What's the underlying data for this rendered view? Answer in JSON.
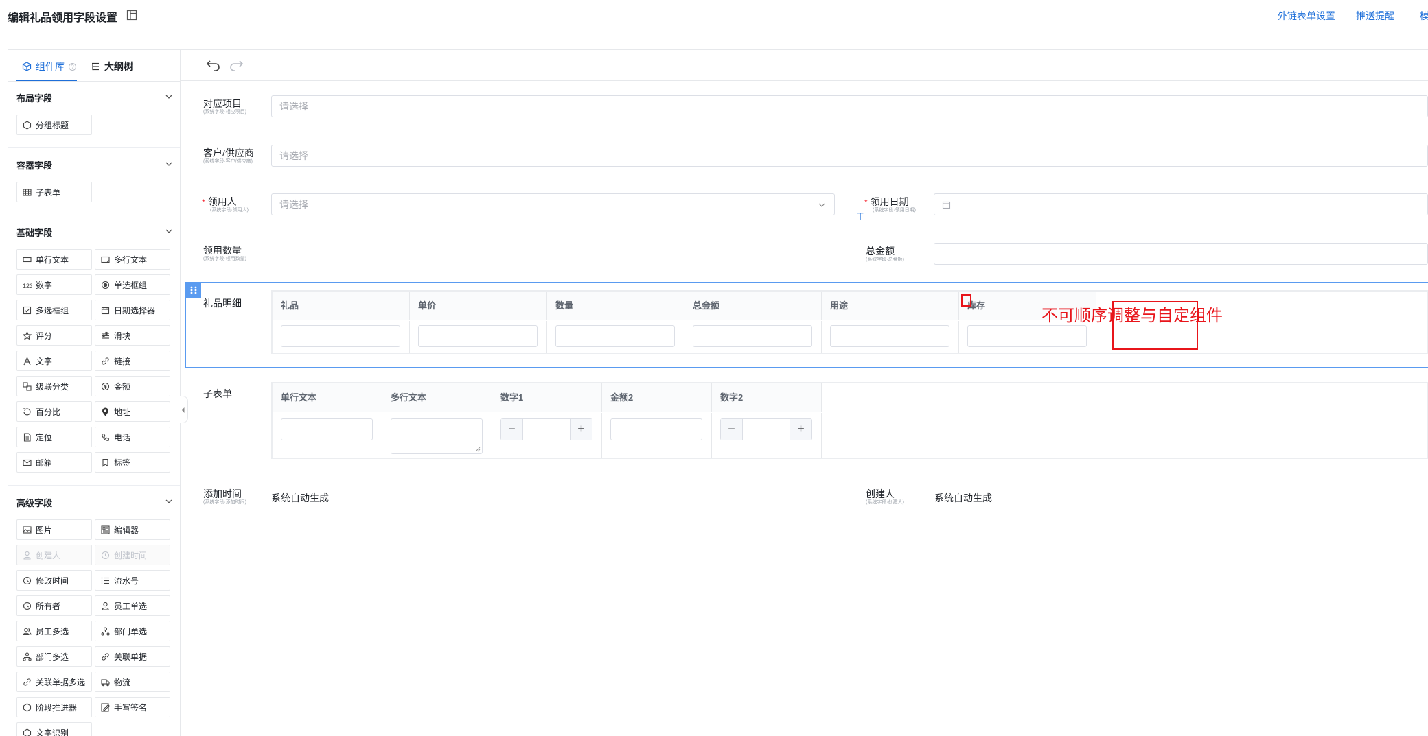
{
  "header": {
    "title": "编辑礼品领用字段设置",
    "links": [
      "外链表单设置",
      "推送提醒",
      "模"
    ]
  },
  "left_panel": {
    "tabs": [
      {
        "label": "组件库",
        "icon": "cube-icon",
        "help": "?"
      },
      {
        "label": "大纲树",
        "icon": "tree-outline-icon"
      }
    ],
    "sections": [
      {
        "title": "布局字段",
        "items": [
          {
            "label": "分组标题",
            "icon": "group-title-icon"
          }
        ]
      },
      {
        "title": "容器字段",
        "items": [
          {
            "label": "子表单",
            "icon": "table-icon"
          }
        ]
      },
      {
        "title": "基础字段",
        "items": [
          {
            "label": "单行文本",
            "icon": "single-line-text-icon"
          },
          {
            "label": "多行文本",
            "icon": "multi-line-text-icon"
          },
          {
            "label": "数字",
            "icon": "number-icon"
          },
          {
            "label": "单选框组",
            "icon": "radio-icon"
          },
          {
            "label": "多选框组",
            "icon": "checkbox-icon"
          },
          {
            "label": "日期选择器",
            "icon": "calendar-icon"
          },
          {
            "label": "评分",
            "icon": "star-icon"
          },
          {
            "label": "滑块",
            "icon": "slider-icon"
          },
          {
            "label": "文字",
            "icon": "text-icon"
          },
          {
            "label": "链接",
            "icon": "link-icon"
          },
          {
            "label": "级联分类",
            "icon": "cascade-icon"
          },
          {
            "label": "金额",
            "icon": "money-icon"
          },
          {
            "label": "百分比",
            "icon": "percent-icon"
          },
          {
            "label": "地址",
            "icon": "location-pin-icon"
          },
          {
            "label": "定位",
            "icon": "position-icon"
          },
          {
            "label": "电话",
            "icon": "phone-icon"
          },
          {
            "label": "邮箱",
            "icon": "mail-icon"
          },
          {
            "label": "标签",
            "icon": "tag-icon"
          }
        ]
      },
      {
        "title": "高级字段",
        "items": [
          {
            "label": "图片",
            "icon": "image-icon"
          },
          {
            "label": "编辑器",
            "icon": "editor-icon"
          },
          {
            "label": "创建人",
            "icon": "user-icon",
            "disabled": true
          },
          {
            "label": "创建时间",
            "icon": "clock-icon",
            "disabled": true
          },
          {
            "label": "修改时间",
            "icon": "clock-icon"
          },
          {
            "label": "流水号",
            "icon": "serial-list-icon"
          },
          {
            "label": "所有者",
            "icon": "owner-clock-icon"
          },
          {
            "label": "员工单选",
            "icon": "user-icon"
          },
          {
            "label": "员工多选",
            "icon": "users-icon"
          },
          {
            "label": "部门单选",
            "icon": "department-icon"
          },
          {
            "label": "部门多选",
            "icon": "department-icon"
          },
          {
            "label": "关联单据",
            "icon": "link-icon"
          },
          {
            "label": "关联单据多选",
            "icon": "link-icon"
          },
          {
            "label": "物流",
            "icon": "truck-icon"
          },
          {
            "label": "阶段推进器",
            "icon": "stage-icon"
          },
          {
            "label": "手写签名",
            "icon": "signature-icon"
          },
          {
            "label": "文字识别",
            "icon": "ocr-icon"
          }
        ]
      }
    ]
  },
  "form": {
    "fields": [
      {
        "label": "对应项目",
        "sub": "(系统字段·相应项目)",
        "placeholder": "请选择"
      },
      {
        "label": "客户/供应商",
        "sub": "(系统字段·客户/供应商)",
        "placeholder": "请选择"
      },
      {
        "label": "领用人",
        "sub": "(系统字段·领用人)",
        "placeholder": "请选择",
        "required": "*"
      },
      {
        "label": "领用日期",
        "sub": "(系统字段·领用日期)",
        "required": "*"
      },
      {
        "label": "领用数量",
        "sub": "(系统字段·领用数量)"
      },
      {
        "label": "总金额",
        "sub": "(系统字段·总金额)"
      }
    ],
    "gift_detail": {
      "label": "礼品明细",
      "columns": [
        "礼品",
        "单价",
        "数量",
        "总金额",
        "用途",
        "库存"
      ]
    },
    "subform": {
      "label": "子表单",
      "columns": [
        "单行文本",
        "多行文本",
        "数字1",
        "金额2",
        "数字2"
      ],
      "stepper_minus": "−",
      "stepper_plus": "+"
    },
    "footer_fields": [
      {
        "label": "添加时间",
        "sub": "(系统字段·添加时间)",
        "value": "系统自动生成"
      },
      {
        "label": "创建人",
        "sub": "(系统字段·创建人)",
        "value": "系统自动生成"
      }
    ]
  },
  "annotation": {
    "text": "不可顺序调整与自定组件",
    "color": "#e8151b"
  },
  "colors": {
    "accent": "#1e6fd9",
    "selection": "#5a9bf0"
  }
}
